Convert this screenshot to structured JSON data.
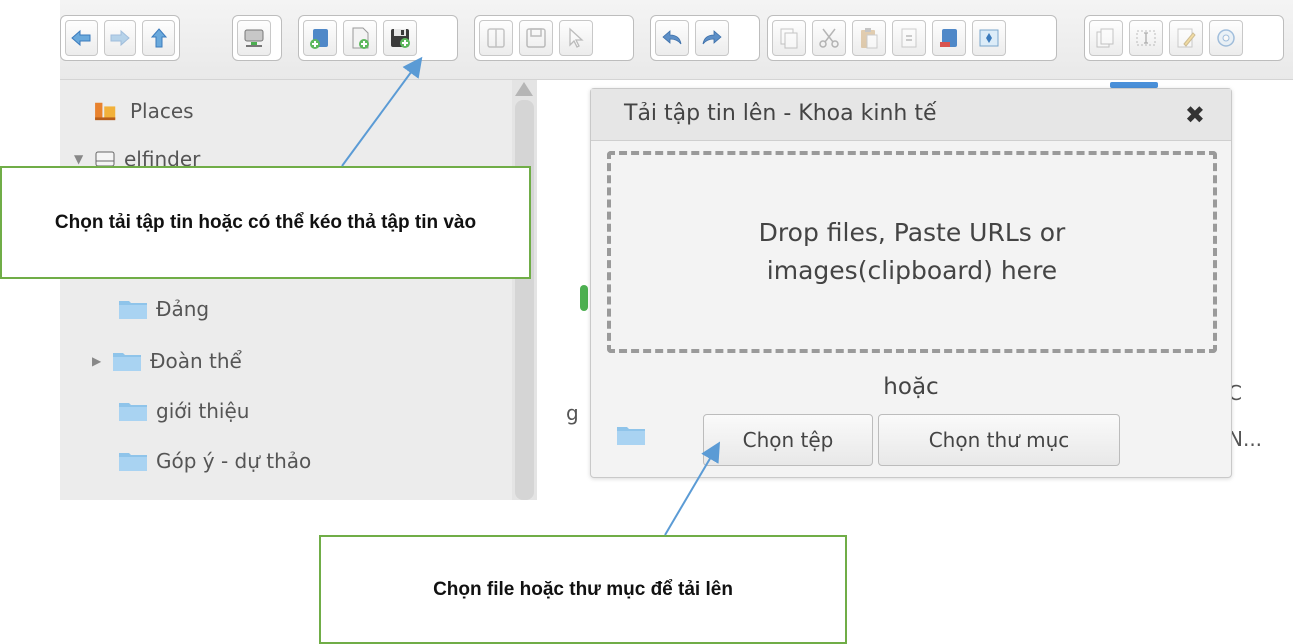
{
  "toolbar": {
    "groups": [
      [
        "back-icon",
        "forward-icon",
        "up-icon"
      ],
      [
        "netmount-icon"
      ],
      [
        "mkdir-icon",
        "mkfile-icon",
        "upload-icon"
      ],
      [
        "open-icon",
        "download-icon",
        "select-icon"
      ],
      [
        "undo-icon",
        "redo-icon"
      ],
      [
        "copy-icon",
        "cut-icon",
        "paste-icon",
        "duplicate-icon",
        "rm-icon",
        "extract-icon"
      ],
      [
        "info-icon",
        "rename-icon",
        "edit-icon",
        "help-icon"
      ]
    ]
  },
  "sidebar": {
    "items": [
      {
        "label": "Places",
        "icon": "places-icon"
      },
      {
        "label": "elfinder",
        "icon": "drive-icon"
      },
      {
        "label": "Đảng",
        "icon": "folder-icon"
      },
      {
        "label": "Đoàn thể",
        "icon": "folder-icon"
      },
      {
        "label": "giới thiệu",
        "icon": "folder-icon"
      },
      {
        "label": "Góp ý - dự thảo",
        "icon": "folder-icon"
      }
    ]
  },
  "workzone": {
    "fragment_left": "g",
    "fragment_right_top": "C",
    "fragment_right_bottom": "N..."
  },
  "dialog": {
    "title": "Tải tập tin lên - Khoa kinh tế",
    "close_glyph": "✖",
    "drop_text": "Drop files, Paste URLs or images(clipboard) here",
    "or_text": "hoặc",
    "choose_file_label": "Chọn tệp",
    "choose_folder_label": "Chọn thư mục"
  },
  "callouts": {
    "top": "Chọn tải tập tin hoặc có thể kéo thả tập tin vào",
    "bottom": "Chọn file hoặc thư mục để tải lên"
  },
  "colors": {
    "callout_border": "#70ad47",
    "arrow": "#5b9bd5",
    "folder": "#8fc4ea"
  }
}
